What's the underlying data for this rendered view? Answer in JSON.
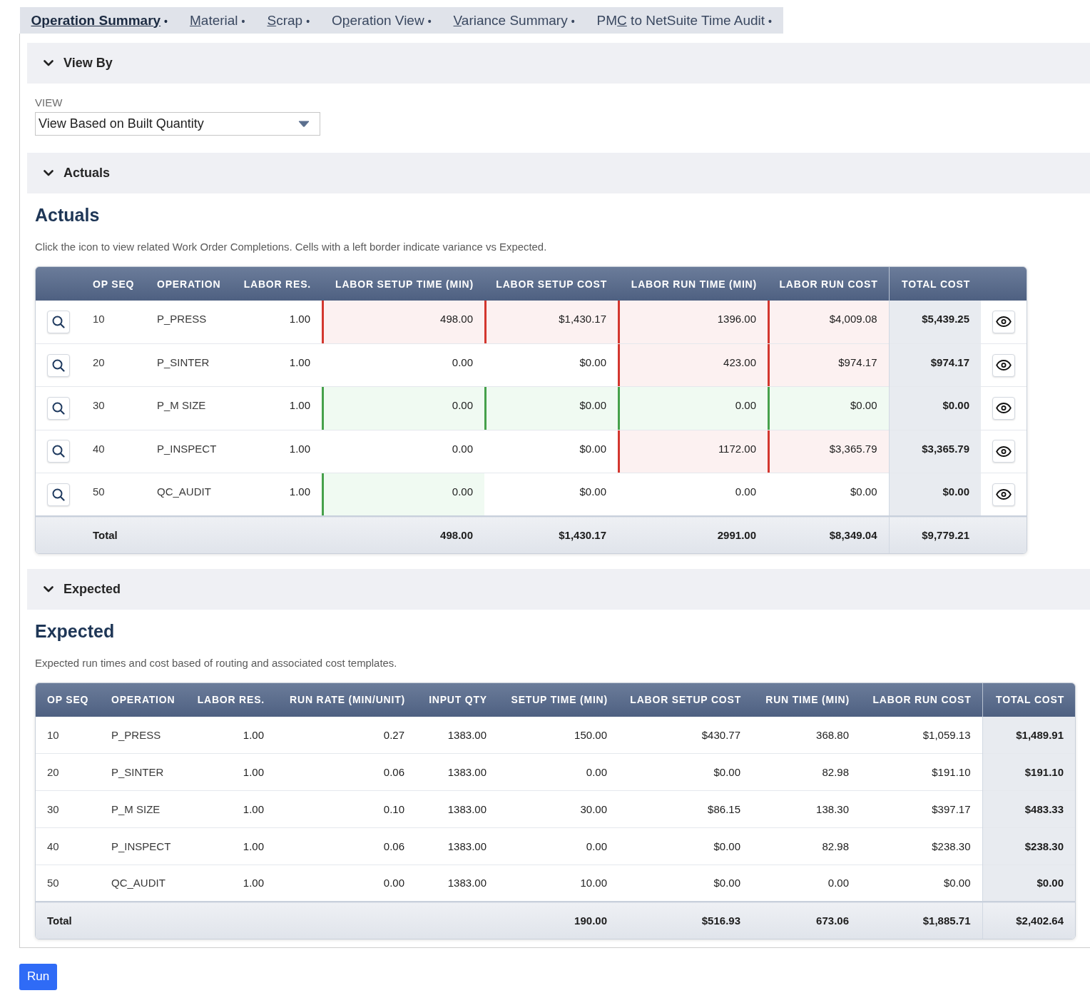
{
  "tabs": [
    {
      "access_key": "Operation Summary",
      "bullet": "•",
      "selected": true
    },
    {
      "access_key": "M",
      "text_after": "aterial",
      "bullet": "•",
      "selected": false
    },
    {
      "access_key": "S",
      "text_after": "crap",
      "bullet": "•",
      "selected": false
    },
    {
      "text_before": "O",
      "access_key": "p",
      "text_after": "eration View",
      "bullet": "•",
      "selected": false
    },
    {
      "access_key": "V",
      "text_after": "ariance Summary",
      "bullet": "•",
      "selected": false
    },
    {
      "text_before": "PM",
      "access_key": "C",
      "text_after": " to NetSuite Time Audit",
      "bullet": "•",
      "selected": false
    }
  ],
  "sections": [
    {
      "kind": "field",
      "title": "View By",
      "expanded": true,
      "field": {
        "label": "VIEW",
        "value": "View Based on Built Quantity"
      }
    },
    {
      "kind": "table",
      "title": "Actuals",
      "expanded": true,
      "heading": "Actuals",
      "description": "Click the icon to view related Work Order Completions. Cells with a left border indicate variance vs Expected.",
      "table": {
        "lookup_buttons": true,
        "view_buttons": true,
        "columns": [
          {
            "label": "OP SEQ",
            "kind": "text"
          },
          {
            "label": "OPERATION",
            "kind": "text"
          },
          {
            "label": "LABOR RES.",
            "kind": "number"
          },
          {
            "label": "LABOR SETUP TIME (MIN)",
            "kind": "number"
          },
          {
            "label": "LABOR SETUP COST",
            "kind": "number"
          },
          {
            "label": "LABOR RUN TIME (MIN)",
            "kind": "number"
          },
          {
            "label": "LABOR RUN COST",
            "kind": "number"
          },
          {
            "label": "TOTAL COST",
            "kind": "total"
          }
        ],
        "rows": [
          {
            "cells": [
              {
                "text": "10"
              },
              {
                "text": "P_PRESS"
              },
              {
                "text": "1.00"
              },
              {
                "text": "498.00",
                "over": true,
                "under": false
              },
              {
                "text": "$1,430.17",
                "over": true,
                "under": false
              },
              {
                "text": "1396.00",
                "over": true,
                "under": false
              },
              {
                "text": "$4,009.08",
                "over": true,
                "under": false
              },
              {
                "text": "$5,439.25"
              }
            ]
          },
          {
            "cells": [
              {
                "text": "20"
              },
              {
                "text": "P_SINTER"
              },
              {
                "text": "1.00"
              },
              {
                "text": "0.00",
                "over": false,
                "under": false
              },
              {
                "text": "$0.00",
                "over": false,
                "under": false
              },
              {
                "text": "423.00",
                "over": true,
                "under": false
              },
              {
                "text": "$974.17",
                "over": true,
                "under": false
              },
              {
                "text": "$974.17"
              }
            ]
          },
          {
            "cells": [
              {
                "text": "30"
              },
              {
                "text": "P_M SIZE"
              },
              {
                "text": "1.00"
              },
              {
                "text": "0.00",
                "over": false,
                "under": true
              },
              {
                "text": "$0.00",
                "over": false,
                "under": true
              },
              {
                "text": "0.00",
                "over": false,
                "under": true
              },
              {
                "text": "$0.00",
                "over": false,
                "under": true
              },
              {
                "text": "$0.00"
              }
            ]
          },
          {
            "cells": [
              {
                "text": "40"
              },
              {
                "text": "P_INSPECT"
              },
              {
                "text": "1.00"
              },
              {
                "text": "0.00",
                "over": false,
                "under": false
              },
              {
                "text": "$0.00",
                "over": false,
                "under": false
              },
              {
                "text": "1172.00",
                "over": true,
                "under": false
              },
              {
                "text": "$3,365.79",
                "over": true,
                "under": false
              },
              {
                "text": "$3,365.79"
              }
            ]
          },
          {
            "cells": [
              {
                "text": "50"
              },
              {
                "text": "QC_AUDIT"
              },
              {
                "text": "1.00"
              },
              {
                "text": "0.00",
                "over": false,
                "under": true
              },
              {
                "text": "$0.00",
                "over": false,
                "under": false
              },
              {
                "text": "0.00",
                "over": false,
                "under": false
              },
              {
                "text": "$0.00",
                "over": false,
                "under": false
              },
              {
                "text": "$0.00"
              }
            ]
          }
        ],
        "totals": {
          "label": "Total",
          "values": [
            "498.00",
            "$1,430.17",
            "2991.00",
            "$8,349.04",
            "$9,779.21"
          ]
        }
      }
    },
    {
      "kind": "table",
      "title": "Expected",
      "expanded": true,
      "heading": "Expected",
      "description": "Expected run times and cost based of routing and associated cost templates.",
      "table": {
        "columns": [
          {
            "label": "OP SEQ",
            "kind": "text"
          },
          {
            "label": "OPERATION",
            "kind": "text"
          },
          {
            "label": "LABOR RES.",
            "kind": "number"
          },
          {
            "label": "RUN RATE (MIN/UNIT)",
            "kind": "number"
          },
          {
            "label": "INPUT QTY",
            "kind": "number"
          },
          {
            "label": "SETUP TIME (MIN)",
            "kind": "number"
          },
          {
            "label": "LABOR SETUP COST",
            "kind": "number"
          },
          {
            "label": "RUN TIME (MIN)",
            "kind": "number"
          },
          {
            "label": "LABOR RUN COST",
            "kind": "number"
          },
          {
            "label": "TOTAL COST",
            "kind": "total"
          }
        ],
        "rows": [
          {
            "cells": [
              {
                "text": "10"
              },
              {
                "text": "P_PRESS"
              },
              {
                "text": "1.00"
              },
              {
                "text": "0.27"
              },
              {
                "text": "1383.00"
              },
              {
                "text": "150.00"
              },
              {
                "text": "$430.77"
              },
              {
                "text": "368.80"
              },
              {
                "text": "$1,059.13"
              },
              {
                "text": "$1,489.91"
              }
            ]
          },
          {
            "cells": [
              {
                "text": "20"
              },
              {
                "text": "P_SINTER"
              },
              {
                "text": "1.00"
              },
              {
                "text": "0.06"
              },
              {
                "text": "1383.00"
              },
              {
                "text": "0.00"
              },
              {
                "text": "$0.00"
              },
              {
                "text": "82.98"
              },
              {
                "text": "$191.10"
              },
              {
                "text": "$191.10"
              }
            ]
          },
          {
            "cells": [
              {
                "text": "30"
              },
              {
                "text": "P_M SIZE"
              },
              {
                "text": "1.00"
              },
              {
                "text": "0.10"
              },
              {
                "text": "1383.00"
              },
              {
                "text": "30.00"
              },
              {
                "text": "$86.15"
              },
              {
                "text": "138.30"
              },
              {
                "text": "$397.17"
              },
              {
                "text": "$483.33"
              }
            ]
          },
          {
            "cells": [
              {
                "text": "40"
              },
              {
                "text": "P_INSPECT"
              },
              {
                "text": "1.00"
              },
              {
                "text": "0.06"
              },
              {
                "text": "1383.00"
              },
              {
                "text": "0.00"
              },
              {
                "text": "$0.00"
              },
              {
                "text": "82.98"
              },
              {
                "text": "$238.30"
              },
              {
                "text": "$238.30"
              }
            ]
          },
          {
            "cells": [
              {
                "text": "50"
              },
              {
                "text": "QC_AUDIT"
              },
              {
                "text": "1.00"
              },
              {
                "text": "0.00"
              },
              {
                "text": "1383.00"
              },
              {
                "text": "10.00"
              },
              {
                "text": "$0.00"
              },
              {
                "text": "0.00"
              },
              {
                "text": "$0.00"
              },
              {
                "text": "$0.00"
              }
            ]
          }
        ],
        "totals": {
          "label": "Total",
          "values": [
            "190.00",
            "$516.93",
            "673.06",
            "$1,885.71",
            "$2,402.64"
          ]
        }
      }
    }
  ],
  "run_button": {
    "label": "Run"
  }
}
